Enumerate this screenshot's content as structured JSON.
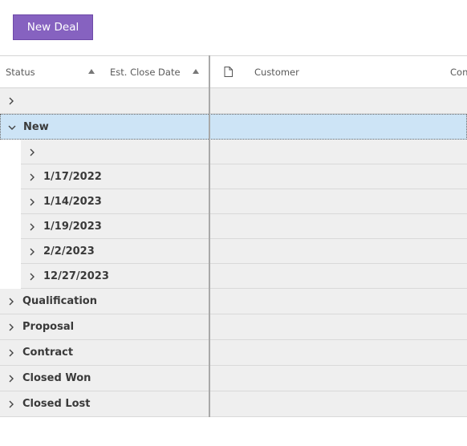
{
  "toolbar": {
    "new_deal_label": "New Deal"
  },
  "columns": {
    "status": "Status",
    "est_close_date": "Est. Close Date",
    "customer": "Customer",
    "partial": "Con"
  },
  "groups": [
    {
      "label": "",
      "expanded": false
    },
    {
      "label": "New",
      "expanded": true,
      "selected": true,
      "children": [
        "",
        "1/17/2022",
        "1/14/2023",
        "1/19/2023",
        "2/2/2023",
        "12/27/2023"
      ]
    },
    {
      "label": "Qualification",
      "expanded": false
    },
    {
      "label": "Proposal",
      "expanded": false
    },
    {
      "label": "Contract",
      "expanded": false
    },
    {
      "label": "Closed Won",
      "expanded": false
    },
    {
      "label": "Closed Lost",
      "expanded": false
    }
  ],
  "colors": {
    "accent": "#8662c0",
    "selected_row": "#cde4f6",
    "row_bg": "#efefef"
  },
  "icons": {
    "expand": "chevron-right-icon",
    "collapse": "chevron-down-icon",
    "column": "document-icon",
    "sort": "sort-ascending-icon"
  }
}
